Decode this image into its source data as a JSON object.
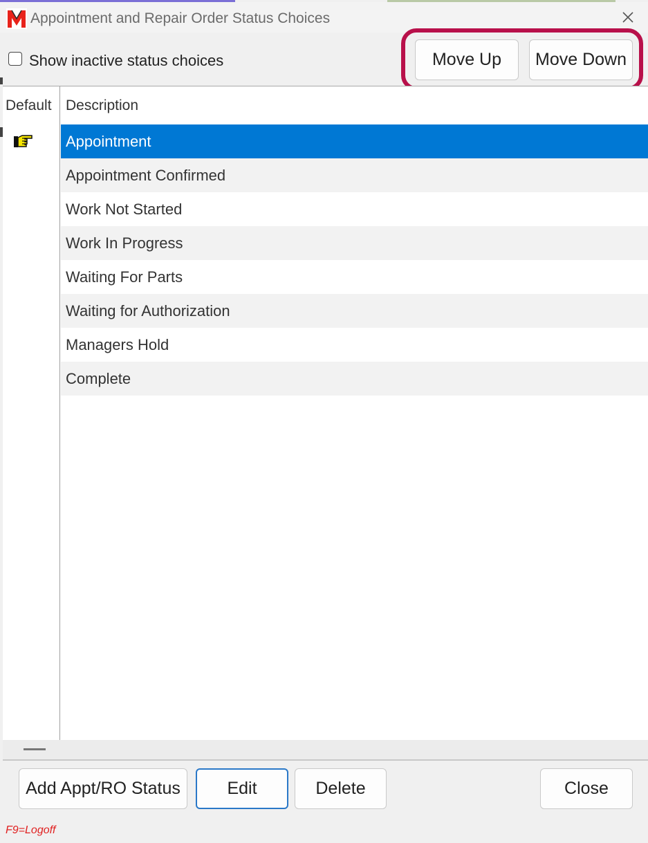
{
  "window": {
    "title": "Appointment and Repair Order Status Choices"
  },
  "toolbar": {
    "show_inactive_label": "Show inactive status choices",
    "show_inactive_checked": false,
    "move_up_label": "Move Up",
    "move_down_label": "Move Down"
  },
  "grid": {
    "columns": [
      "Default",
      "Description"
    ],
    "default_row_index": 0,
    "selected_row_index": 0,
    "rows": [
      {
        "description": "Appointment"
      },
      {
        "description": "Appointment Confirmed"
      },
      {
        "description": "Work Not Started"
      },
      {
        "description": "Work In Progress"
      },
      {
        "description": "Waiting For Parts"
      },
      {
        "description": "Waiting for Authorization"
      },
      {
        "description": "Managers Hold"
      },
      {
        "description": "Complete"
      }
    ]
  },
  "footer": {
    "add_label": "Add Appt/RO Status",
    "edit_label": "Edit",
    "delete_label": "Delete",
    "close_label": "Close",
    "hotkey_hint": "F9=Logoff"
  },
  "icons": {
    "app_logo": "m-logo-icon",
    "close": "close-icon",
    "default_marker": "pointing-hand-icon"
  },
  "colors": {
    "selection": "#0078d4",
    "highlight_frame": "#b8104a",
    "hotkey_text": "#e02020",
    "logo_red": "#e8231b"
  }
}
